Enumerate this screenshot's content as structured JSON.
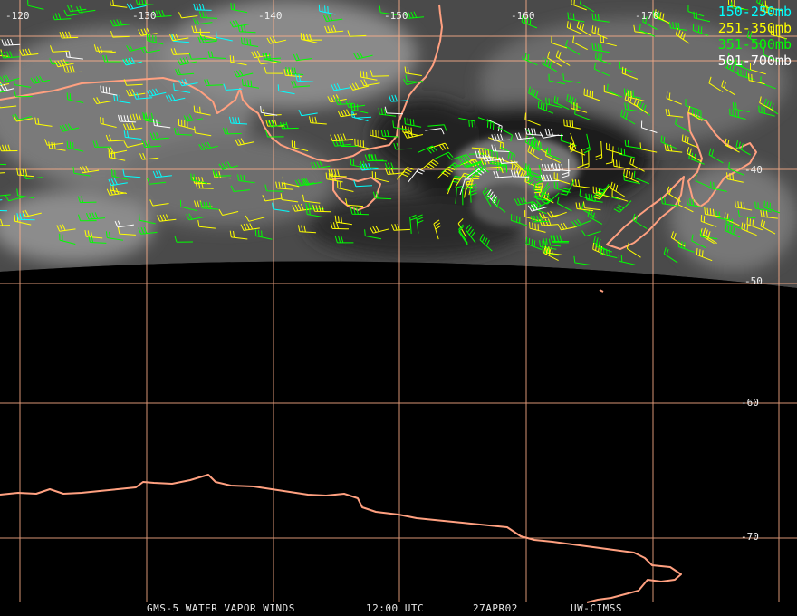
{
  "image": {
    "satellite_product": "GMS-5 WATER VAPOR WINDS",
    "time": "12:00 UTC",
    "date": "27APR02",
    "credit": "UW-CIMSS"
  },
  "longitude_labels": [
    "-120",
    "-130",
    "-140",
    "-150",
    "-160",
    "-170"
  ],
  "latitude_labels": [
    "-40",
    "-50",
    "-60",
    "-70"
  ],
  "legend": [
    {
      "label": "150-250mb",
      "color": "#00ffff"
    },
    {
      "label": "251-350mb",
      "color": "#ffff00"
    },
    {
      "label": "351-500mb",
      "color": "#00ff00"
    },
    {
      "label": "501-700mb",
      "color": "#ffffff"
    }
  ],
  "colors": {
    "background": "#000000",
    "graticule": "#ffb08a",
    "coastline": "#ffa080"
  }
}
